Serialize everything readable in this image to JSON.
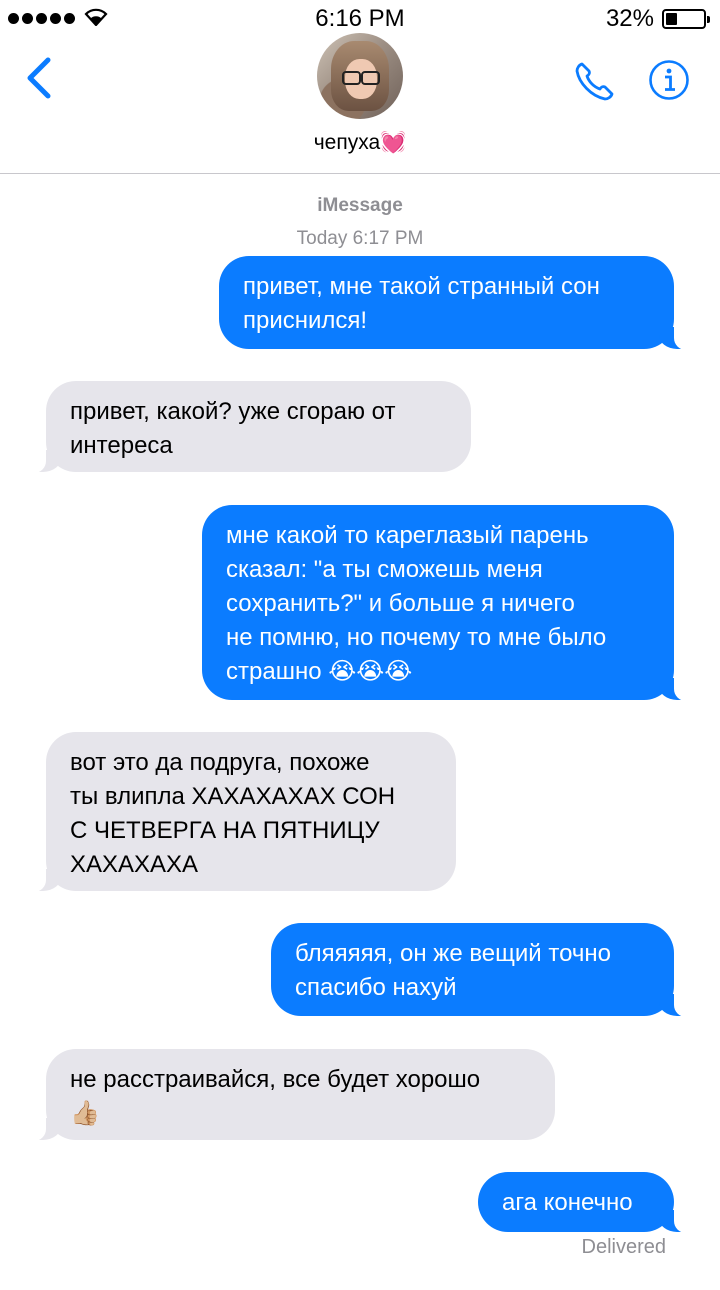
{
  "status_bar": {
    "time": "6:16 PM",
    "battery_percent": "32%",
    "battery_level": 0.32,
    "signal_bars": 5
  },
  "header": {
    "contact_name": "чепуха💓",
    "back_icon": "chevron-left-icon",
    "call_icon": "phone-icon",
    "info_icon": "info-icon"
  },
  "conversation": {
    "service": "iMessage",
    "timestamp": "Today 6:17 PM",
    "messages": [
      {
        "direction": "outgoing",
        "text": "привет, мне такой странный сон\nприснился!"
      },
      {
        "direction": "incoming",
        "text": "привет, какой? уже сгораю от\nинтереса"
      },
      {
        "direction": "outgoing",
        "text": "мне какой то кареглазый парень\nсказал: \"а ты сможешь меня\nсохранить?\" и больше я ничего\nне помню, но почему то мне было\nстрашно 😭😭😭"
      },
      {
        "direction": "incoming",
        "text": "вот это да подруга, похоже\nты влипла ХАХАХАХАХ СОН\nС ЧЕТВЕРГА НА ПЯТНИЦУ\nХАХАХАХА"
      },
      {
        "direction": "outgoing",
        "text": "бляяяяя, он же вещий точно\nспасибо нахуй"
      },
      {
        "direction": "incoming",
        "text": "не расстраивайся, все будет хорошо\n👍🏼"
      },
      {
        "direction": "outgoing",
        "text": "ага конечно"
      }
    ],
    "delivery_status": "Delivered"
  },
  "colors": {
    "outgoing_bubble": "#0b7cff",
    "incoming_bubble": "#e6e5eb",
    "accent": "#0b7cff",
    "meta_text": "#8e8e93"
  }
}
